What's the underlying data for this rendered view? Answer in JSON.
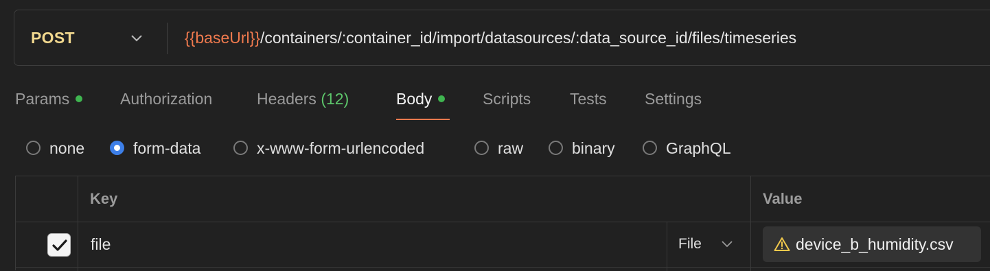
{
  "request": {
    "method": "POST",
    "url_variable": "{{baseUrl}}",
    "url_path": "/containers/:container_id/import/datasources/:data_source_id/files/timeseries"
  },
  "tabs": [
    {
      "label": "Params",
      "has_dot": true
    },
    {
      "label": "Authorization"
    },
    {
      "label": "Headers",
      "count": "(12)"
    },
    {
      "label": "Body",
      "has_dot": true,
      "active": true
    },
    {
      "label": "Scripts"
    },
    {
      "label": "Tests"
    },
    {
      "label": "Settings"
    }
  ],
  "body_types": [
    {
      "label": "none",
      "checked": false
    },
    {
      "label": "form-data",
      "checked": true
    },
    {
      "label": "x-www-form-urlencoded",
      "checked": false
    },
    {
      "label": "raw",
      "checked": false
    },
    {
      "label": "binary",
      "checked": false
    },
    {
      "label": "GraphQL",
      "checked": false
    }
  ],
  "table": {
    "headers": {
      "key": "Key",
      "value": "Value"
    },
    "rows": [
      {
        "checked": true,
        "key": "file",
        "type": "File",
        "value": "device_b_humidity.csv",
        "value_icon": "warning-icon"
      }
    ]
  },
  "colors": {
    "accent": "#f07a4e",
    "method": "#f2d98f",
    "dot": "#3fb550",
    "radio_checked": "#3d7fe8",
    "warning": "#f2c94c"
  }
}
